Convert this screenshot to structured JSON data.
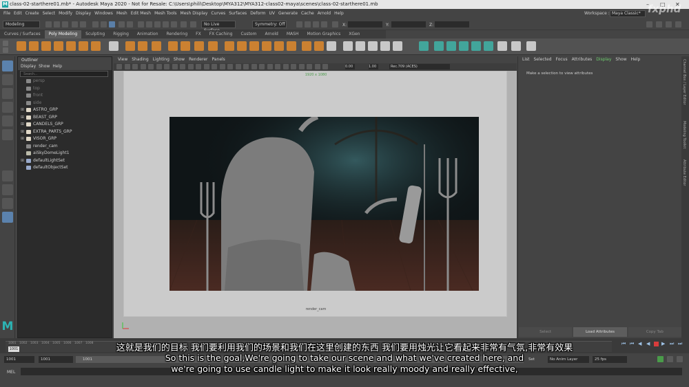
{
  "window": {
    "title": "class-02-starthere01.mb* - Autodesk Maya 2020 - Not for Resale: C:\\Users\\phili\\Desktop\\MYA312\\MYA312-class02-maya\\scenes\\class-02-starthere01.mb"
  },
  "menus": [
    "File",
    "Edit",
    "Create",
    "Select",
    "Modify",
    "Display",
    "Windows",
    "Mesh",
    "Edit Mesh",
    "Mesh Tools",
    "Mesh Display",
    "Curves",
    "Surfaces",
    "Deform",
    "UV",
    "Generate",
    "Cache",
    "Arnold",
    "Help"
  ],
  "workspace": {
    "label": "Workspace :",
    "value": "Maya Classic*"
  },
  "watermark": "fxphd",
  "statusline": {
    "mode": "Modeling",
    "live_surface": "No Live Surface",
    "symmetry": "Symmetry: Off",
    "x_label": "X:",
    "y_label": "Y:",
    "z_label": "Z:"
  },
  "shelf_tabs": [
    "Curves / Surfaces",
    "Poly Modeling",
    "Sculpting",
    "Rigging",
    "Animation",
    "Rendering",
    "FX",
    "FX Caching",
    "Custom",
    "Arnold",
    "MASH",
    "Motion Graphics",
    "XGen"
  ],
  "shelf_active": "Poly Modeling",
  "outliner": {
    "title": "Outliner",
    "menu": [
      "Display",
      "Show",
      "Help"
    ],
    "search_placeholder": "Search...",
    "items": [
      {
        "name": "persp",
        "dim": true,
        "expand": false
      },
      {
        "name": "top",
        "dim": true,
        "expand": false
      },
      {
        "name": "front",
        "dim": true,
        "expand": false
      },
      {
        "name": "side",
        "dim": true,
        "expand": false
      },
      {
        "name": "ASTRO_GRP",
        "dim": false,
        "expand": true
      },
      {
        "name": "BEAST_GRP",
        "dim": false,
        "expand": true
      },
      {
        "name": "CANDELS_GRP",
        "dim": false,
        "expand": true
      },
      {
        "name": "EXTRA_PARTS_GRP",
        "dim": false,
        "expand": true
      },
      {
        "name": "VISOR_GRP",
        "dim": false,
        "expand": true
      },
      {
        "name": "render_cam",
        "dim": false,
        "expand": false
      },
      {
        "name": "aiSkyDomeLight1",
        "dim": false,
        "expand": false
      },
      {
        "name": "defaultLightSet",
        "dim": false,
        "expand": true
      },
      {
        "name": "defaultObjectSet",
        "dim": false,
        "expand": false
      }
    ]
  },
  "viewport": {
    "menu": [
      "View",
      "Shading",
      "Lighting",
      "Show",
      "Renderer",
      "Panels"
    ],
    "exposure": "0.00",
    "gamma": "1.00",
    "colorspace": "Rec.709 (ACES)",
    "resolution": "1920 x 1080",
    "camera": "render_cam"
  },
  "attribute_editor": {
    "tabs": [
      "List",
      "Selected",
      "Focus",
      "Attributes",
      "Display",
      "Show",
      "Help"
    ],
    "active_tab": "Display",
    "message": "Make a selection to view attributes",
    "buttons": [
      "Select",
      "Load Attributes",
      "Copy Tab"
    ]
  },
  "side_tabs": [
    "Channel Box / Layer Editor",
    "Modeling Toolkit",
    "Attribute Editor"
  ],
  "timeline": {
    "ticks": [
      "1001",
      "1002",
      "1003",
      "1004",
      "1005",
      "1006",
      "1007",
      "1008"
    ],
    "current": "1001"
  },
  "range": {
    "start": "1001",
    "inner_start": "1001",
    "inner_end": "1001",
    "set_label": "Set",
    "anim_layer": "No Anim Layer",
    "fps": "25 fps"
  },
  "command": {
    "label": "MEL"
  },
  "subtitles": {
    "chinese": "这就是我们的目标 我们要利用我们的场景和我们在这里创建的东西 我们要用烛光让它看起来非常有气氛,非常有效果",
    "line1": "So this is the goal,We're going to take our scene and what we've created here, and",
    "line2": "we're going to use candle light to make it look really moody and really effective,"
  }
}
